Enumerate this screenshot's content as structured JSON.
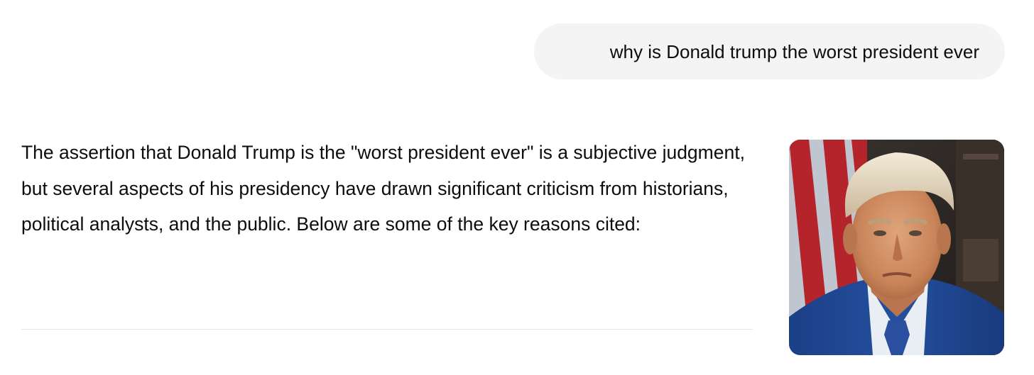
{
  "conversation": {
    "user_message": "why is Donald trump the worst president ever",
    "assistant_message": "The assertion that Donald Trump is the \"worst president ever\" is a subjective judgment, but several aspects of his presidency have drawn significant criticism from historians, political analysts, and the public. Below are some of the key reasons cited:"
  },
  "media": {
    "portrait_icon": "portrait-image"
  },
  "colors": {
    "user_bubble_bg": "#f4f4f4",
    "text": "#0d0d0d",
    "divider": "#e6e6e6"
  }
}
